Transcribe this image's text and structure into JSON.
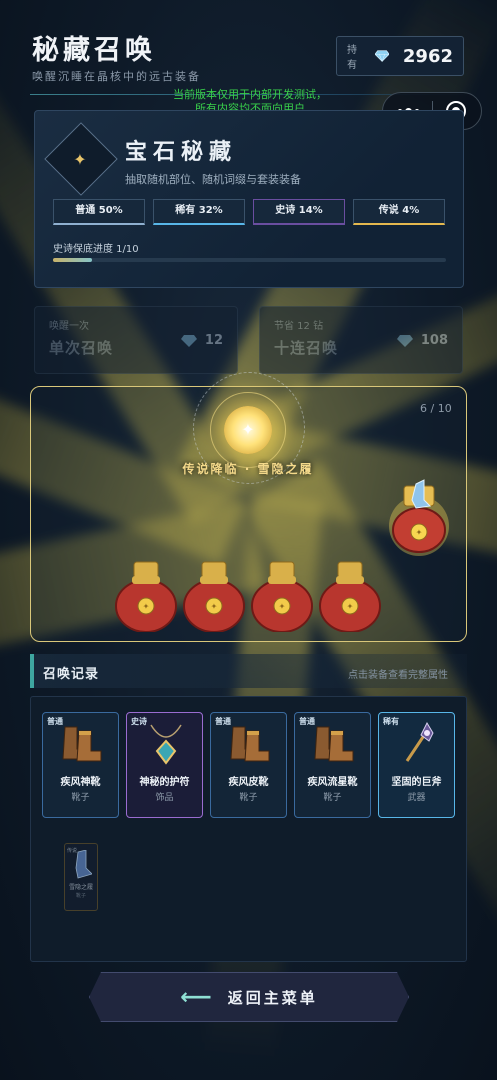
{
  "header": {
    "title": "秘藏召唤",
    "subtitle": "唤醒沉睡在晶核中的远古装备",
    "currency_label": "持有",
    "currency_value": "2962",
    "currency_icon": "diamond-icon"
  },
  "notice": {
    "line1": "当前版本仅用于内部开发测试，",
    "line2": "所有内容均不面向用户"
  },
  "banner": {
    "title": "宝石秘藏",
    "description": "抽取随机部位、随机词缀与套装装备",
    "rates": [
      {
        "label": "普通 50%",
        "color": "#8fb0d0"
      },
      {
        "label": "稀有 32%",
        "color": "#58b6e8"
      },
      {
        "label": "史诗 14%",
        "color": "#9a6cd0"
      },
      {
        "label": "传说 4%",
        "color": "#e4b84e"
      }
    ],
    "pity_label": "史诗保底进度 1/10",
    "pity_fraction": 0.1
  },
  "summon": {
    "single": {
      "hint": "唤醒一次",
      "name": "单次召唤",
      "cost": "12"
    },
    "ten": {
      "hint": "节省 12 钻",
      "name": "十连召唤",
      "cost": "108"
    }
  },
  "result": {
    "counter": "6 / 10",
    "announce": "传说降临 · 雪隐之履"
  },
  "records": {
    "title": "召唤记录",
    "hint": "点击装备查看完整属性",
    "items": [
      {
        "rarity": "普通",
        "name": "疾风神靴",
        "type": "靴子",
        "icon": "boots-icon"
      },
      {
        "rarity": "史诗",
        "name": "神秘的护符",
        "type": "饰品",
        "icon": "amulet-icon"
      },
      {
        "rarity": "普通",
        "name": "疾风皮靴",
        "type": "靴子",
        "icon": "boots-icon"
      },
      {
        "rarity": "普通",
        "name": "疾风流星靴",
        "type": "靴子",
        "icon": "boots-icon"
      },
      {
        "rarity": "稀有",
        "name": "坚固的巨斧",
        "type": "武器",
        "icon": "axe-icon"
      }
    ],
    "pending": {
      "rarity": "传说",
      "name": "雪隐之履",
      "type": "靴子",
      "icon": "crystal-boot-icon"
    }
  },
  "footer": {
    "back_label": "返回主菜单"
  }
}
